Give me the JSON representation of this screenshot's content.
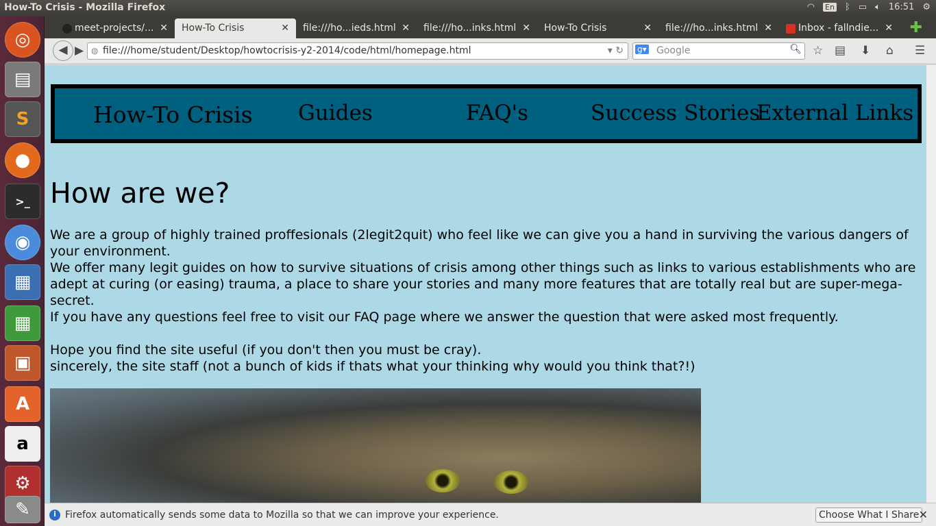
{
  "os": {
    "window_title": "How-To Crisis - Mozilla Firefox",
    "keyboard": "En",
    "clock": "16:51"
  },
  "tabs": [
    {
      "label": "meet-projects/...",
      "icon": "github-icon"
    },
    {
      "label": "How-To Crisis",
      "active": true
    },
    {
      "label": "file:///ho...ieds.html"
    },
    {
      "label": "file:///ho...inks.html"
    },
    {
      "label": "How-To Crisis"
    },
    {
      "label": "file:///ho...inks.html"
    },
    {
      "label": "Inbox - fallndie...",
      "icon": "gmail-icon"
    }
  ],
  "navbar": {
    "url": "file:///home/student/Desktop/howtocrisis-y2-2014/code/html/homepage.html",
    "search_placeholder": "Google"
  },
  "page": {
    "nav": [
      "How-To Crisis",
      "Guides",
      "FAQ's",
      "Success Stories",
      "External Links"
    ],
    "heading": "How are we?",
    "paragraphs": [
      "We are a group of highly trained proffesionals (2legit2quit) who feel like we can give you a hand in surviving the various dangers of your environment.",
      "We offer many legit guides on how to survive situations of crisis among other things such as links to various establishments who are adept at curing (or easing) trauma, a place to share your stories and many more features that are totally real but are super-mega-secret.",
      "If you have any questions feel free to visit our FAQ page where we answer the question that were asked most frequently.",
      "",
      "Hope you find the site useful (if you don't then you must be cray).",
      "sincerely, the site staff (not a bunch of kids if thats what your thinking why would you think that?!)"
    ]
  },
  "notification": {
    "message": "Firefox automatically sends some data to Mozilla so that we can improve your experience.",
    "button": "Choose What I Share"
  }
}
